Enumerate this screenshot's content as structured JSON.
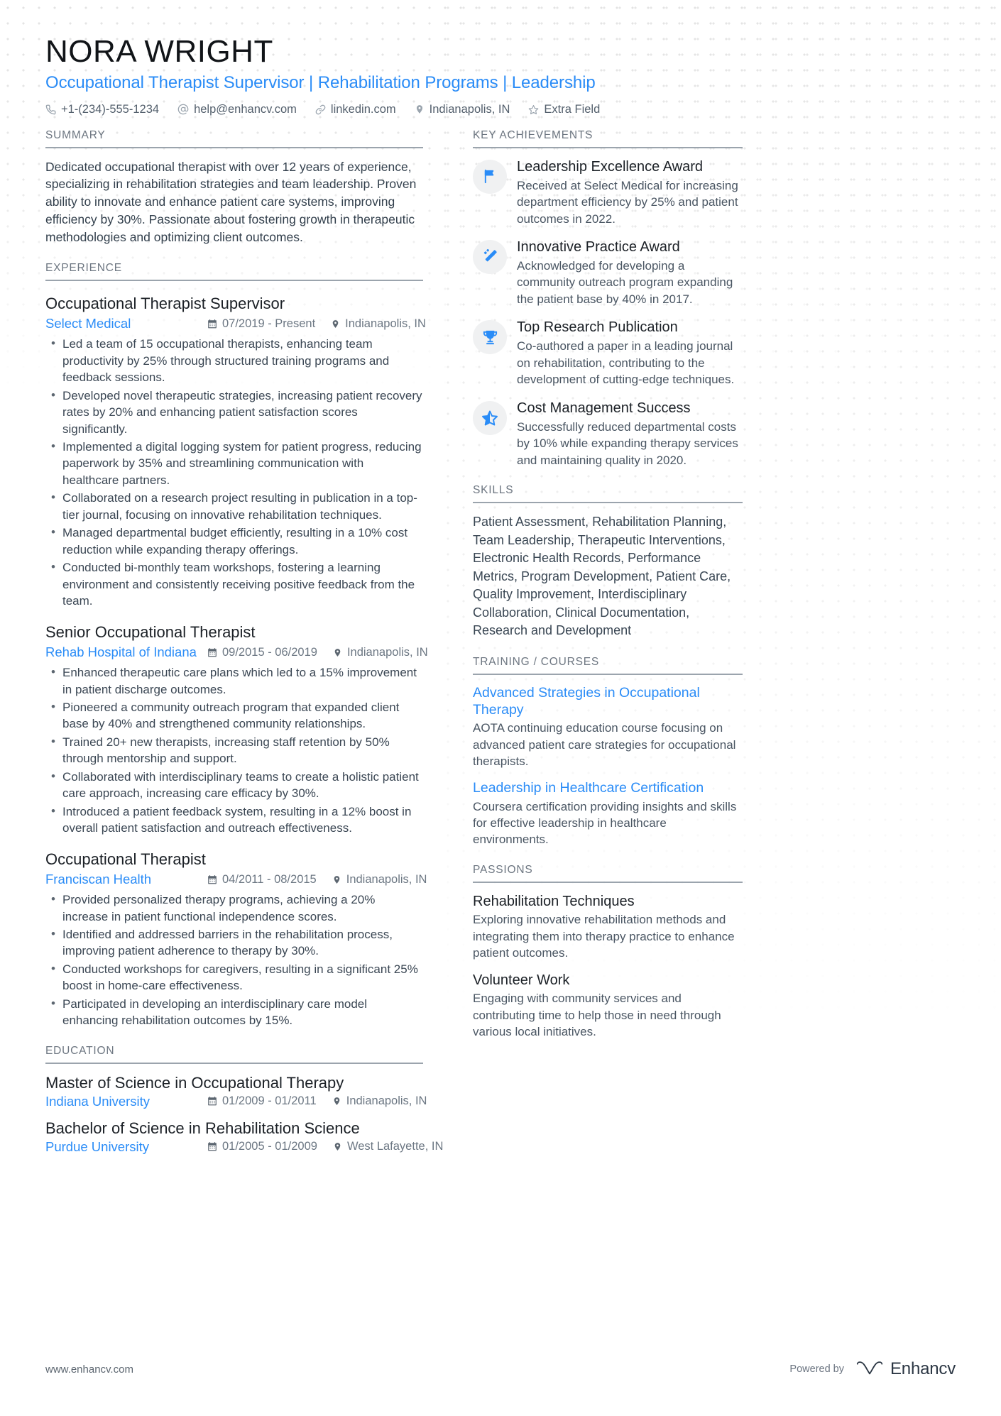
{
  "header": {
    "name": "NORA WRIGHT",
    "headline": "Occupational Therapist Supervisor | Rehabilitation Programs | Leadership",
    "contacts": [
      {
        "icon": "phone-icon",
        "text": "+1-(234)-555-1234"
      },
      {
        "icon": "email-icon",
        "text": "help@enhancv.com"
      },
      {
        "icon": "link-icon",
        "text": "linkedin.com"
      },
      {
        "icon": "location-pin-icon",
        "text": "Indianapolis, IN"
      },
      {
        "icon": "star-outline-icon",
        "text": "Extra Field"
      }
    ]
  },
  "colors": {
    "accent": "#2a8cf7",
    "heading": "#1b2026",
    "body": "#3b4754",
    "section_label": "#6d7681",
    "rule": "#9ba4ad",
    "icon_bubble": "#f0f1f2"
  },
  "summary": {
    "title": "SUMMARY",
    "text": "Dedicated occupational therapist with over 12 years of experience, specializing in rehabilitation strategies and team leadership. Proven ability to innovate and enhance patient care systems, improving efficiency by 30%. Passionate about fostering growth in therapeutic methodologies and optimizing client outcomes."
  },
  "experience": {
    "title": "EXPERIENCE",
    "entries": [
      {
        "job_title": "Occupational Therapist Supervisor",
        "company": "Select Medical",
        "dates": "07/2019 - Present",
        "location": "Indianapolis, IN",
        "bullets": [
          "Led a team of 15 occupational therapists, enhancing team productivity by 25% through structured training programs and feedback sessions.",
          "Developed novel therapeutic strategies, increasing patient recovery rates by 20% and enhancing patient satisfaction scores significantly.",
          "Implemented a digital logging system for patient progress, reducing paperwork by 35% and streamlining communication with healthcare partners.",
          "Collaborated on a research project resulting in publication in a top-tier journal, focusing on innovative rehabilitation techniques.",
          "Managed departmental budget efficiently, resulting in a 10% cost reduction while expanding therapy offerings.",
          "Conducted bi-monthly team workshops, fostering a learning environment and consistently receiving positive feedback from the team."
        ]
      },
      {
        "job_title": "Senior Occupational Therapist",
        "company": "Rehab Hospital of Indiana",
        "dates": "09/2015 - 06/2019",
        "location": "Indianapolis, IN",
        "bullets": [
          "Enhanced therapeutic care plans which led to a 15% improvement in patient discharge outcomes.",
          "Pioneered a community outreach program that expanded client base by 40% and strengthened community relationships.",
          "Trained 20+ new therapists, increasing staff retention by 50% through mentorship and support.",
          "Collaborated with interdisciplinary teams to create a holistic patient care approach, increasing care efficacy by 30%.",
          "Introduced a patient feedback system, resulting in a 12% boost in overall patient satisfaction and outreach effectiveness."
        ]
      },
      {
        "job_title": "Occupational Therapist",
        "company": "Franciscan Health",
        "dates": "04/2011 - 08/2015",
        "location": "Indianapolis, IN",
        "bullets": [
          "Provided personalized therapy programs, achieving a 20% increase in patient functional independence scores.",
          "Identified and addressed barriers in the rehabilitation process, improving patient adherence to therapy by 30%.",
          "Conducted workshops for caregivers, resulting in a significant 25% boost in home-care effectiveness.",
          "Participated in developing an interdisciplinary care model enhancing rehabilitation outcomes by 15%."
        ]
      }
    ]
  },
  "education": {
    "title": "EDUCATION",
    "entries": [
      {
        "degree": "Master of Science in Occupational Therapy",
        "school": "Indiana University",
        "dates": "01/2009 - 01/2011",
        "location": "Indianapolis, IN"
      },
      {
        "degree": "Bachelor of Science in Rehabilitation Science",
        "school": "Purdue University",
        "dates": "01/2005 - 01/2009",
        "location": "West Lafayette, IN"
      }
    ]
  },
  "key_achievements": {
    "title": "KEY ACHIEVEMENTS",
    "items": [
      {
        "icon": "flag-icon",
        "title": "Leadership Excellence Award",
        "desc": "Received at Select Medical for increasing department efficiency by 25% and patient outcomes in 2022."
      },
      {
        "icon": "magic-wand-icon",
        "title": "Innovative Practice Award",
        "desc": "Acknowledged for developing a community outreach program expanding the patient base by 40% in 2017."
      },
      {
        "icon": "trophy-icon",
        "title": "Top Research Publication",
        "desc": "Co-authored a paper in a leading journal on rehabilitation, contributing to the development of cutting-edge techniques."
      },
      {
        "icon": "half-star-icon",
        "title": "Cost Management Success",
        "desc": "Successfully reduced departmental costs by 10% while expanding therapy services and maintaining quality in 2020."
      }
    ]
  },
  "skills": {
    "title": "SKILLS",
    "text": "Patient Assessment, Rehabilitation Planning, Team Leadership, Therapeutic Interventions, Electronic Health Records, Performance Metrics, Program Development, Patient Care, Quality Improvement, Interdisciplinary Collaboration, Clinical Documentation, Research and Development"
  },
  "training": {
    "title": "TRAINING / COURSES",
    "entries": [
      {
        "name": "Advanced Strategies in Occupational Therapy",
        "desc": "AOTA continuing education course focusing on advanced patient care strategies for occupational therapists."
      },
      {
        "name": "Leadership in Healthcare Certification",
        "desc": "Coursera certification providing insights and skills for effective leadership in healthcare environments."
      }
    ]
  },
  "passions": {
    "title": "PASSIONS",
    "entries": [
      {
        "name": "Rehabilitation Techniques",
        "desc": "Exploring innovative rehabilitation methods and integrating them into therapy practice to enhance patient outcomes."
      },
      {
        "name": "Volunteer Work",
        "desc": "Engaging with community services and contributing time to help those in need through various local initiatives."
      }
    ]
  },
  "footer": {
    "url": "www.enhancv.com",
    "powered_by": "Powered by",
    "brand": "Enhancv"
  }
}
